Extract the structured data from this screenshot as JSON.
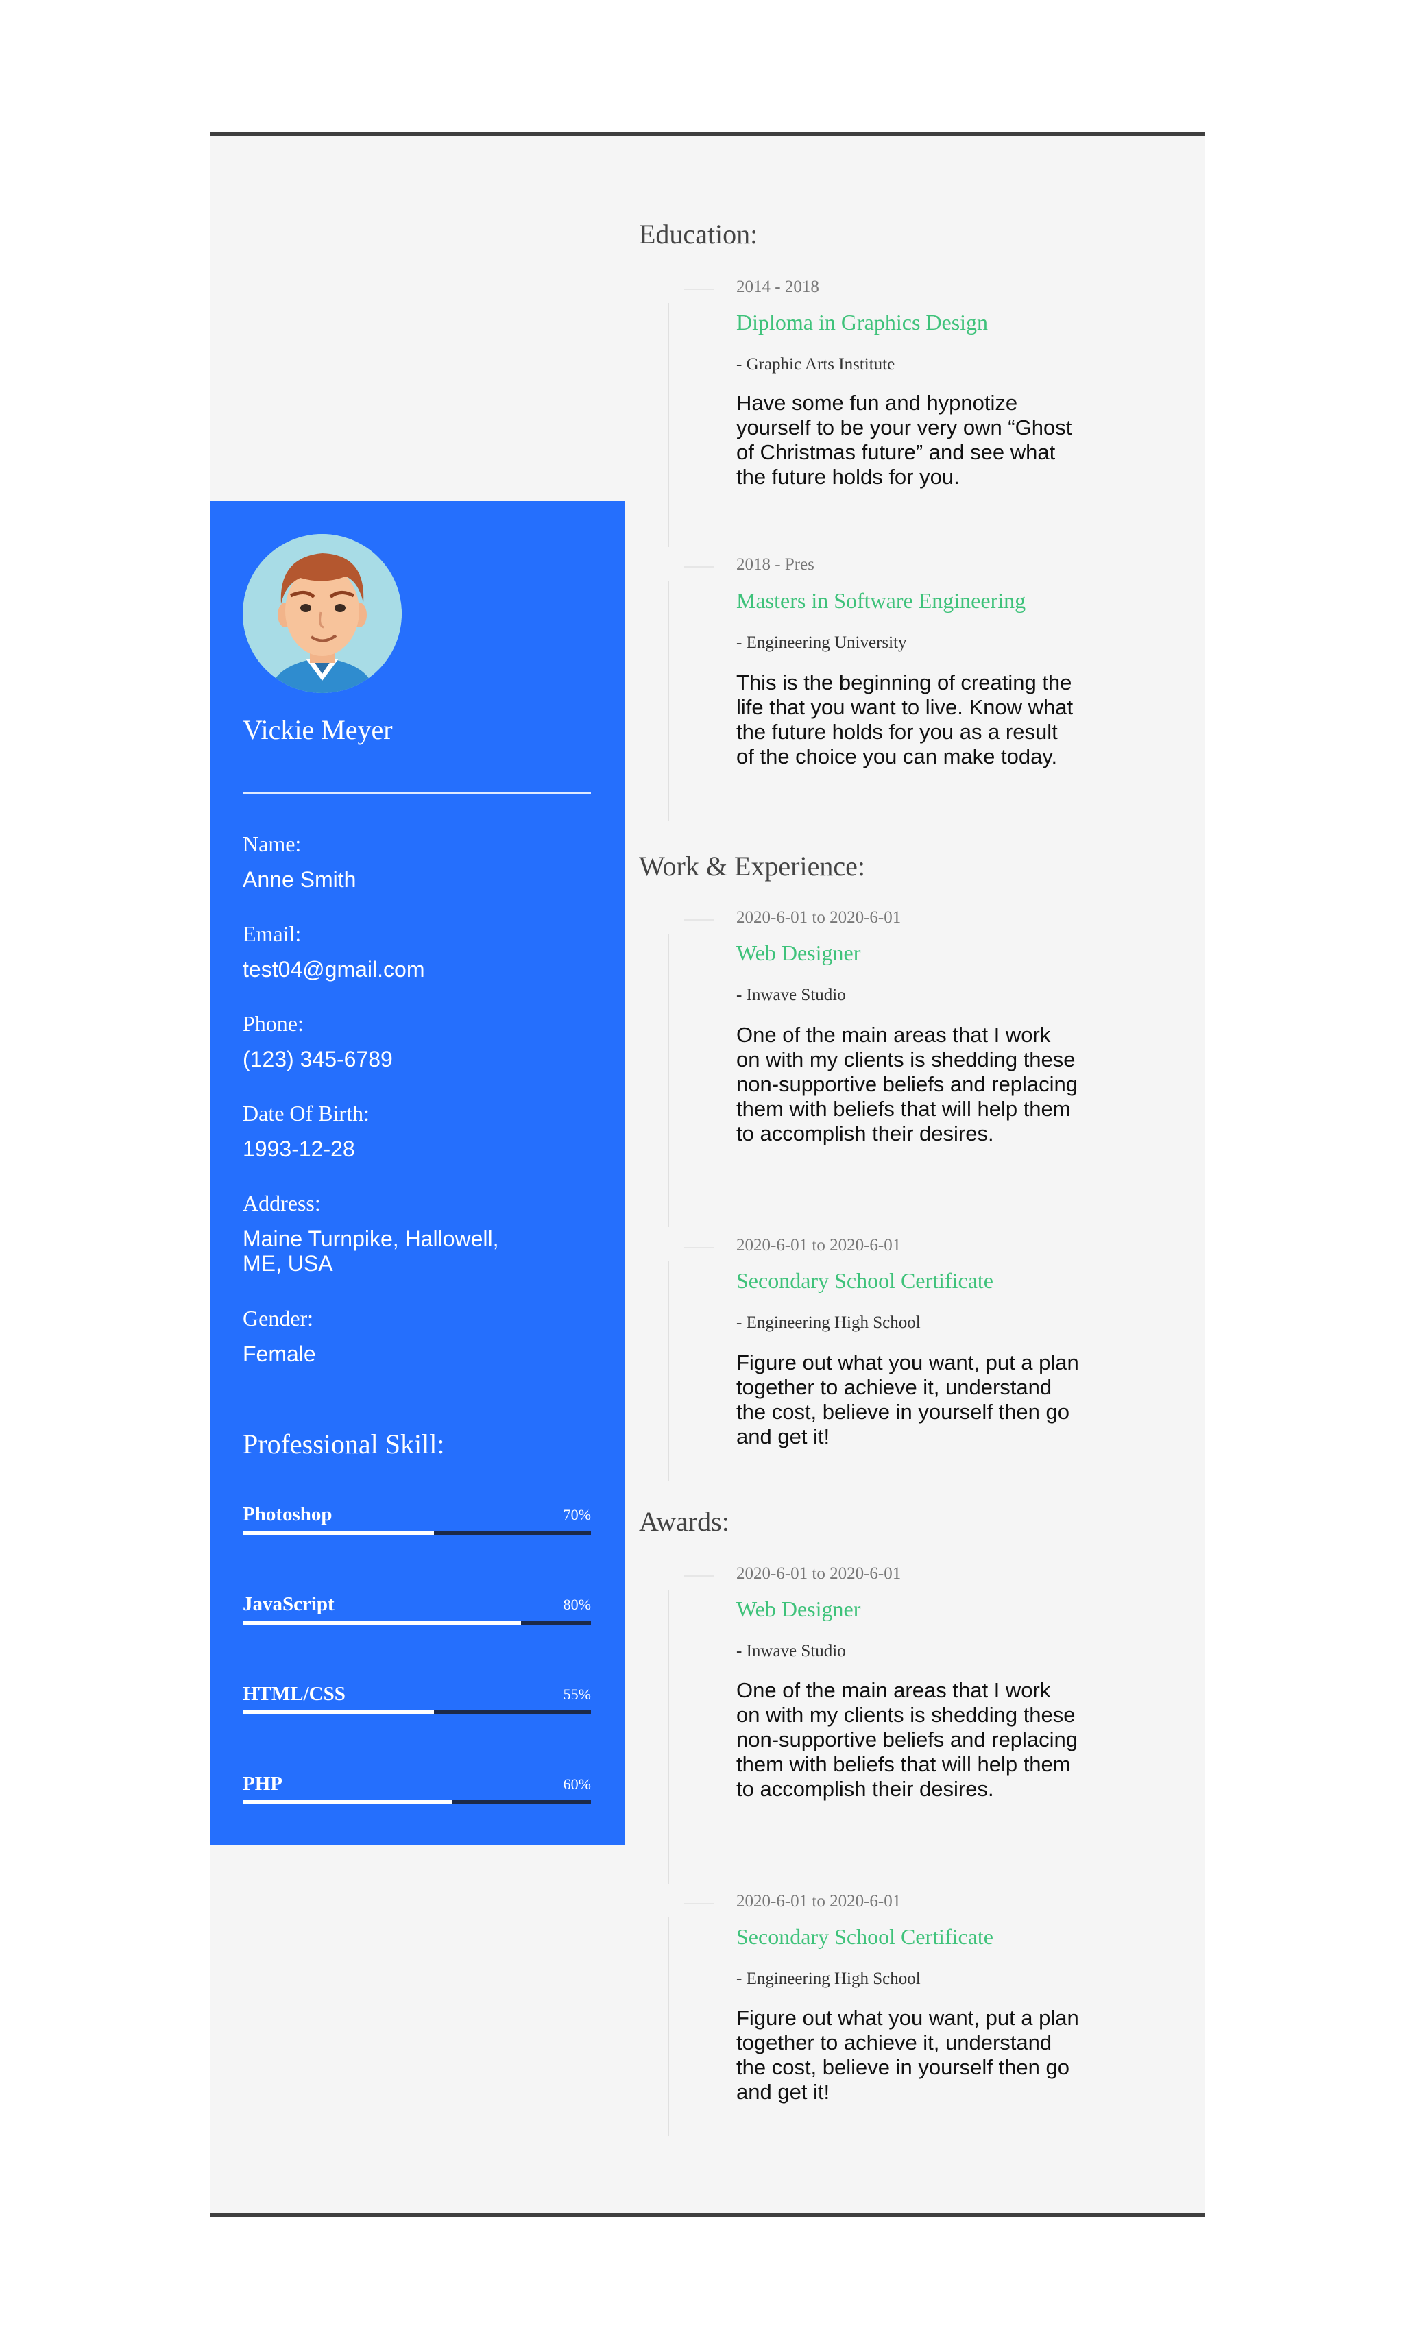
{
  "profile": {
    "name": "Vickie Meyer"
  },
  "info": [
    {
      "label": "Name:",
      "value": "Anne Smith"
    },
    {
      "label": "Email:",
      "value": "test04@gmail.com"
    },
    {
      "label": "Phone:",
      "value": "(123) 345-6789"
    },
    {
      "label": "Date Of Birth:",
      "value": "1993-12-28"
    },
    {
      "label": "Address:",
      "value": "Maine Turnpike, Hallowell, ME, USA"
    },
    {
      "label": "Gender:",
      "value": "Female"
    }
  ],
  "skills": {
    "heading": "Professional Skill:",
    "items": [
      {
        "name": "Photoshop",
        "percent_label": "70%",
        "level": 0.55
      },
      {
        "name": "JavaScript",
        "percent_label": "80%",
        "level": 0.8
      },
      {
        "name": "HTML/CSS",
        "percent_label": "55%",
        "level": 0.55
      },
      {
        "name": "PHP",
        "percent_label": "60%",
        "level": 0.6
      }
    ]
  },
  "education": {
    "title": "Education:",
    "items": [
      {
        "date": "2014 - 2018",
        "title": "Diploma in Graphics Design",
        "org": "- Graphic Arts Institute",
        "desc": "Have some fun and hypnotize yourself to be your very own “Ghost of Christmas future” and see what the future holds for you."
      },
      {
        "date": "2018 - Pres",
        "title": "Masters in Software Engineering",
        "org": "- Engineering University",
        "desc": "This is the beginning of creating the life that you want to live. Know what the future holds for you as a result of the choice you can make today."
      }
    ]
  },
  "work": {
    "title": "Work & Experience:",
    "items": [
      {
        "date": "2020-6-01 to 2020-6-01",
        "title": "Web Designer",
        "org": "- Inwave Studio",
        "desc": "One of the main areas that I work on with my clients is shedding these non-supportive beliefs and replacing them with beliefs that will help them to accomplish their desires."
      },
      {
        "date": "2020-6-01 to 2020-6-01",
        "title": "Secondary School Certificate",
        "org": "- Engineering High School",
        "desc": "Figure out what you want, put a plan together to achieve it, understand the cost, believe in yourself then go and get it!"
      }
    ]
  },
  "awards": {
    "title": "Awards:",
    "items": [
      {
        "date": "2020-6-01 to 2020-6-01",
        "title": "Web Designer",
        "org": "- Inwave Studio",
        "desc": "One of the main areas that I work on with my clients is shedding these non-supportive beliefs and replacing them with beliefs that will help them to accomplish their desires."
      },
      {
        "date": "2020-6-01 to 2020-6-01",
        "title": "Secondary School Certificate",
        "org": "- Engineering High School",
        "desc": "Figure out what you want, put a plan together to achieve it, understand the cost, believe in yourself then go and get it!"
      }
    ]
  },
  "colors": {
    "sidebar": "#256ffd",
    "accent_green": "#3ec27a",
    "sheet": "#f5f5f5"
  },
  "icons": {
    "avatar": "cartoon-man-avatar-icon"
  }
}
